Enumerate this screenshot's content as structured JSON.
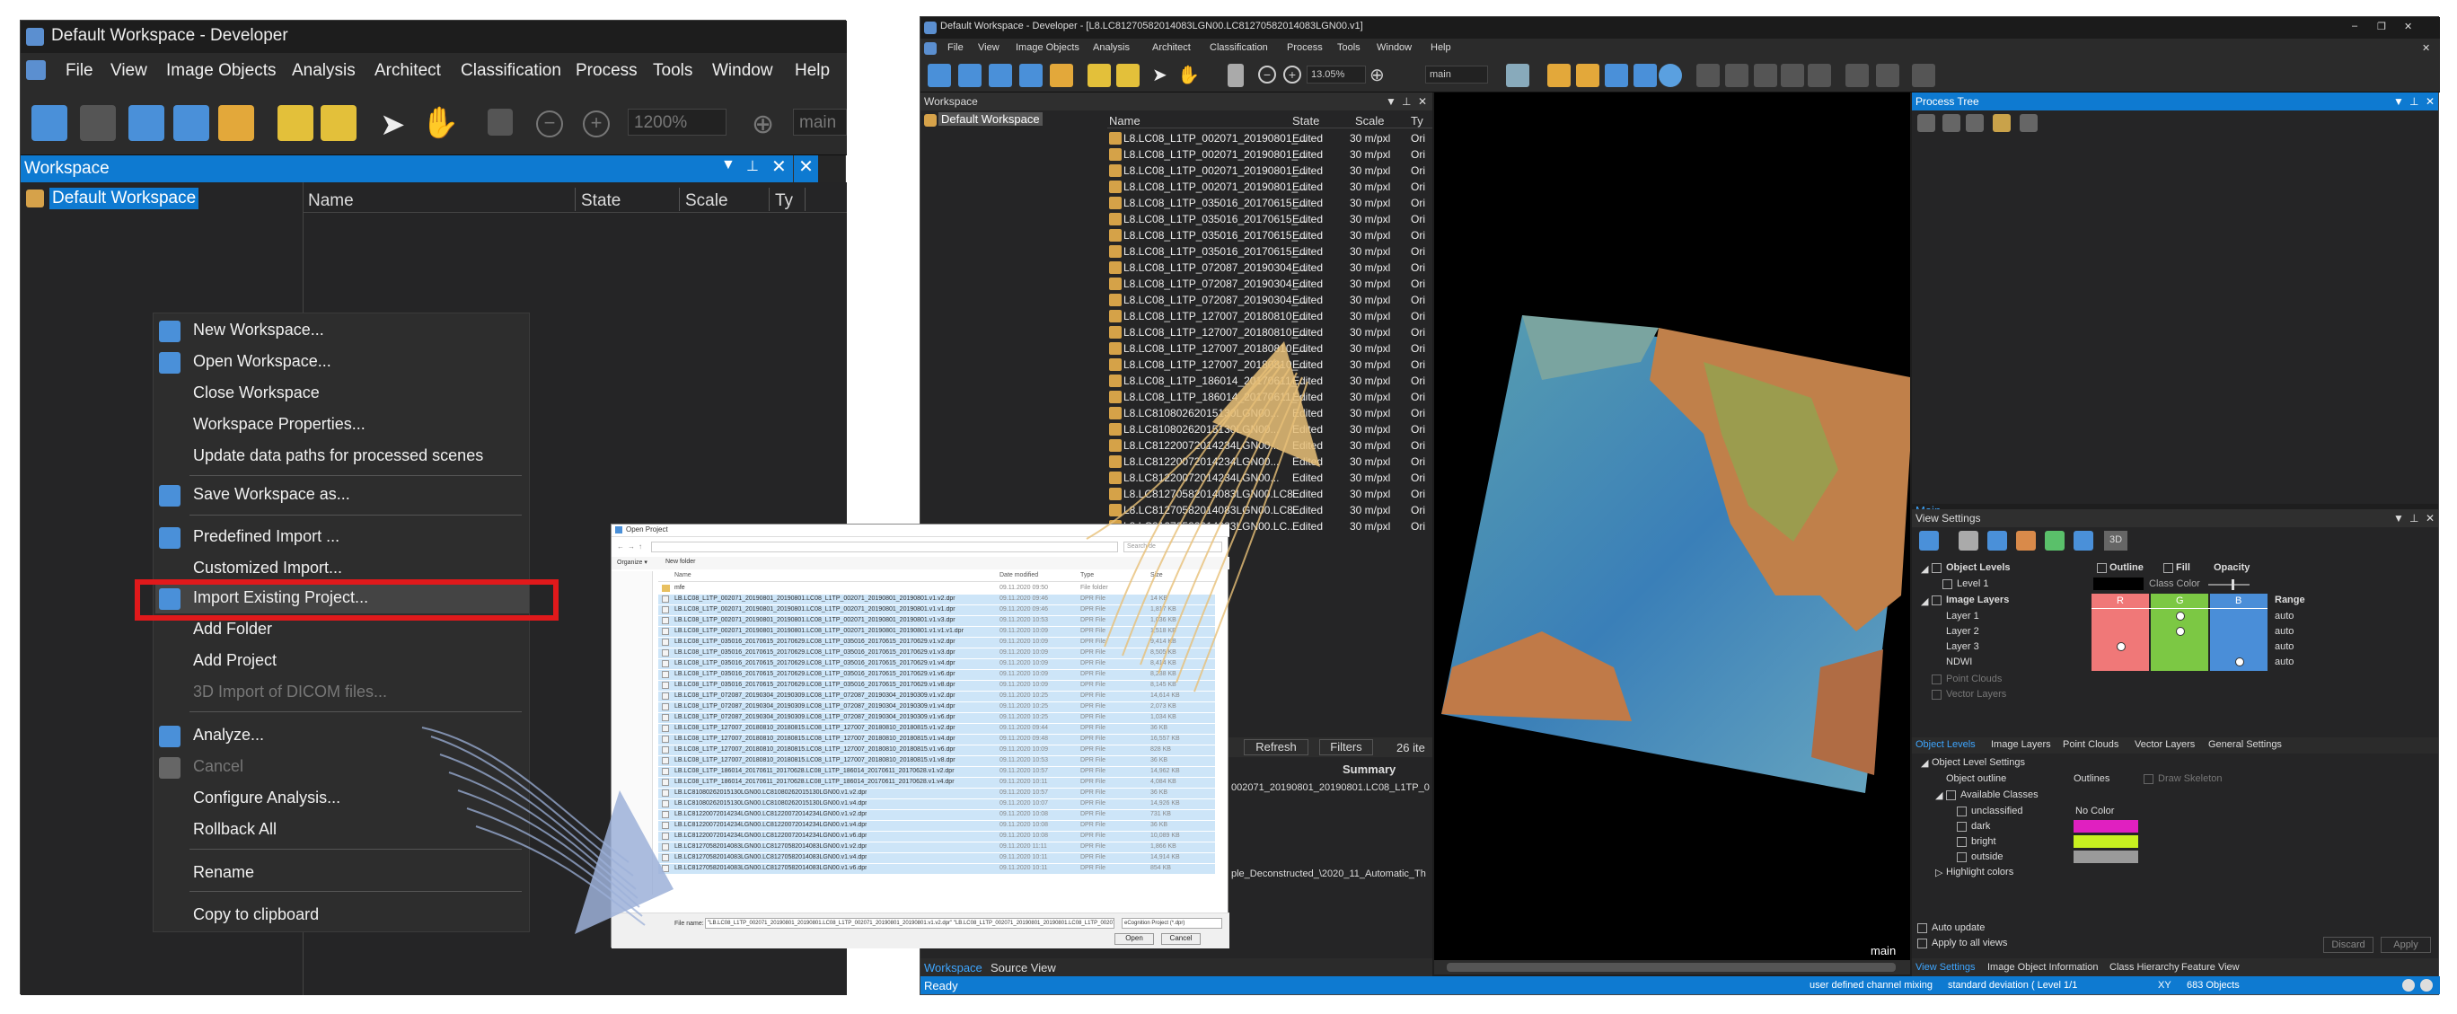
{
  "left_window": {
    "title": "Default Workspace - Developer",
    "menu": [
      "File",
      "View",
      "Image Objects",
      "Analysis",
      "Architect",
      "Classification",
      "Process",
      "Tools",
      "Window",
      "Help"
    ],
    "toolbar": {
      "zoom_value": "1200%",
      "view_select": "main"
    },
    "workspace_pane": {
      "title": "Workspace",
      "tree_root": "Default Workspace",
      "columns": [
        "Name",
        "State",
        "Scale",
        "Ty"
      ]
    }
  },
  "context_menu": {
    "items": [
      {
        "label": "New Workspace...",
        "icon": "new-workspace-icon",
        "enabled": true
      },
      {
        "label": "Open Workspace...",
        "icon": "open-workspace-icon",
        "enabled": true
      },
      {
        "label": "Close Workspace",
        "icon": "",
        "enabled": true
      },
      {
        "label": "Workspace Properties...",
        "icon": "",
        "enabled": true
      },
      {
        "label": "Update data paths for processed scenes",
        "icon": "",
        "enabled": true
      },
      {
        "label": "Save Workspace as...",
        "icon": "save-workspace-icon",
        "enabled": true
      },
      {
        "label": "Predefined Import ...",
        "icon": "predefined-import-icon",
        "enabled": true
      },
      {
        "label": "Customized Import...",
        "icon": "",
        "enabled": true
      },
      {
        "label": "Import Existing Project...",
        "icon": "import-project-icon",
        "enabled": true,
        "highlighted": true
      },
      {
        "label": "Add Folder",
        "icon": "",
        "enabled": true
      },
      {
        "label": "Add Project",
        "icon": "",
        "enabled": true
      },
      {
        "label": "3D Import of DICOM files...",
        "icon": "",
        "enabled": false
      },
      {
        "label": "Analyze...",
        "icon": "analyze-icon",
        "enabled": true
      },
      {
        "label": "Cancel",
        "icon": "cancel-icon",
        "enabled": false
      },
      {
        "label": "Configure Analysis...",
        "icon": "",
        "enabled": true
      },
      {
        "label": "Rollback All",
        "icon": "",
        "enabled": true
      },
      {
        "label": "Rename",
        "icon": "",
        "enabled": true
      },
      {
        "label": "Copy to clipboard",
        "icon": "",
        "enabled": true
      }
    ],
    "highlight_color": "#e0191b"
  },
  "dialog": {
    "title": "Open Project",
    "organize": "Organize ▾",
    "new_folder": "New folder",
    "search_placeholder": "Search de",
    "columns": [
      "Name",
      "Date modified",
      "Type",
      "Size"
    ],
    "folder_row": {
      "name": "mfe",
      "date": "09.11.2020 09:50",
      "type": "File folder",
      "size": ""
    },
    "rows": [
      {
        "name": "LB.LC08_L1TP_002071_20190801_20190801.LC08_L1TP_002071_20190801_20190801.v1.v2.dpr",
        "date": "09.11.2020 09:46",
        "type": "DPR File",
        "size": "14 KB"
      },
      {
        "name": "LB.LC08_L1TP_002071_20190801_20190801.LC08_L1TP_002071_20190801_20190801.v1.v1.dpr",
        "date": "09.11.2020 09:46",
        "type": "DPR File",
        "size": "1,817 KB"
      },
      {
        "name": "LB.LC08_L1TP_002071_20190801_20190801.LC08_L1TP_002071_20190801_20190801.v1.v3.dpr",
        "date": "09.11.2020 10:53",
        "type": "DPR File",
        "size": "1,036 KB"
      },
      {
        "name": "LB.LC08_L1TP_002071_20190801_20190801.LC08_L1TP_002071_20190801_20190801.v1.v1.v1.dpr",
        "date": "09.11.2020 10:09",
        "type": "DPR File",
        "size": "1,518 KB"
      },
      {
        "name": "LB.LC08_L1TP_035016_20170615_20170629.LC08_L1TP_035016_20170615_20170629.v1.v2.dpr",
        "date": "09.11.2020 10:09",
        "type": "DPR File",
        "size": "9,414 KB"
      },
      {
        "name": "LB.LC08_L1TP_035016_20170615_20170629.LC08_L1TP_035016_20170615_20170629.v1.v3.dpr",
        "date": "09.11.2020 10:09",
        "type": "DPR File",
        "size": "8,505 KB"
      },
      {
        "name": "LB.LC08_L1TP_035016_20170615_20170629.LC08_L1TP_035016_20170615_20170629.v1.v4.dpr",
        "date": "09.11.2020 10:09",
        "type": "DPR File",
        "size": "8,414 KB"
      },
      {
        "name": "LB.LC08_L1TP_035016_20170615_20170629.LC08_L1TP_035016_20170615_20170629.v1.v6.dpr",
        "date": "09.11.2020 10:09",
        "type": "DPR File",
        "size": "8,238 KB"
      },
      {
        "name": "LB.LC08_L1TP_035016_20170615_20170629.LC08_L1TP_035016_20170615_20170629.v1.v8.dpr",
        "date": "09.11.2020 10:09",
        "type": "DPR File",
        "size": "8,145 KB"
      },
      {
        "name": "LB.LC08_L1TP_072087_20190304_20190309.LC08_L1TP_072087_20190304_20190309.v1.v2.dpr",
        "date": "09.11.2020 10:25",
        "type": "DPR File",
        "size": "14,614 KB"
      },
      {
        "name": "LB.LC08_L1TP_072087_20190304_20190309.LC08_L1TP_072087_20190304_20190309.v1.v4.dpr",
        "date": "09.11.2020 10:25",
        "type": "DPR File",
        "size": "2,073 KB"
      },
      {
        "name": "LB.LC08_L1TP_072087_20190304_20190309.LC08_L1TP_072087_20190304_20190309.v1.v6.dpr",
        "date": "09.11.2020 10:25",
        "type": "DPR File",
        "size": "1,034 KB"
      },
      {
        "name": "LB.LC08_L1TP_127007_20180810_20180815.LC08_L1TP_127007_20180810_20180815.v1.v2.dpr",
        "date": "09.11.2020 09:44",
        "type": "DPR File",
        "size": "36 KB"
      },
      {
        "name": "LB.LC08_L1TP_127007_20180810_20180815.LC08_L1TP_127007_20180810_20180815.v1.v4.dpr",
        "date": "09.11.2020 09:48",
        "type": "DPR File",
        "size": "16,557 KB"
      },
      {
        "name": "LB.LC08_L1TP_127007_20180810_20180815.LC08_L1TP_127007_20180810_20180815.v1.v6.dpr",
        "date": "09.11.2020 10:09",
        "type": "DPR File",
        "size": "828 KB"
      },
      {
        "name": "LB.LC08_L1TP_127007_20180810_20180815.LC08_L1TP_127007_20180810_20180815.v1.v8.dpr",
        "date": "09.11.2020 10:53",
        "type": "DPR File",
        "size": "36 KB"
      },
      {
        "name": "LB.LC08_L1TP_186014_20170611_20170628.LC08_L1TP_186014_20170611_20170628.v1.v2.dpr",
        "date": "09.11.2020 10:57",
        "type": "DPR File",
        "size": "14,962 KB"
      },
      {
        "name": "LB.LC08_L1TP_186014_20170611_20170628.LC08_L1TP_186014_20170611_20170628.v1.v4.dpr",
        "date": "09.11.2020 10:11",
        "type": "DPR File",
        "size": "4,084 KB"
      },
      {
        "name": "LB.LC81080262015130LGN00.LC81080262015130LGN00.v1.v2.dpr",
        "date": "09.11.2020 10:57",
        "type": "DPR File",
        "size": "36 KB"
      },
      {
        "name": "LB.LC81080262015130LGN00.LC81080262015130LGN00.v1.v4.dpr",
        "date": "09.11.2020 10:07",
        "type": "DPR File",
        "size": "14,926 KB"
      },
      {
        "name": "LB.LC81220072014234LGN00.LC81220072014234LGN00.v1.v2.dpr",
        "date": "09.11.2020 10:08",
        "type": "DPR File",
        "size": "731 KB"
      },
      {
        "name": "LB.LC81220072014234LGN00.LC81220072014234LGN00.v1.v4.dpr",
        "date": "09.11.2020 10:08",
        "type": "DPR File",
        "size": "36 KB"
      },
      {
        "name": "LB.LC81220072014234LGN00.LC81220072014234LGN00.v1.v6.dpr",
        "date": "09.11.2020 10:08",
        "type": "DPR File",
        "size": "10,089 KB"
      },
      {
        "name": "LB.LC81270582014083LGN00.LC81270582014083LGN00.v1.v2.dpr",
        "date": "09.11.2020 11:11",
        "type": "DPR File",
        "size": "1,866 KB"
      },
      {
        "name": "LB.LC81270582014083LGN00.LC81270582014083LGN00.v1.v4.dpr",
        "date": "09.11.2020 10:11",
        "type": "DPR File",
        "size": "14,914 KB"
      },
      {
        "name": "LB.LC81270582014083LGN00.LC81270582014083LGN00.v1.v6.dpr",
        "date": "09.11.2020 10:11",
        "type": "DPR File",
        "size": "854 KB"
      }
    ],
    "file_name_label": "File name:",
    "file_name_value": "\"LB.LC08_L1TP_002071_20190801_20190801.LC08_L1TP_002071_20190801_20190801.v1.v2.dpr\" \"LB.LC08_L1TP_002071_20190801_20190801.LC08_L1TP_002071_20190801_20190801.v",
    "file_type": "eCognition Project (*.dpr)",
    "open_btn": "Open",
    "cancel_btn": "Cancel"
  },
  "right_window": {
    "title": "Default Workspace - Developer - [L8.LC81270582014083LGN00.LC81270582014083LGN00.v1]",
    "menu": [
      "File",
      "View",
      "Image Objects",
      "Analysis",
      "Architect",
      "Classification",
      "Process",
      "Tools",
      "Window",
      "Help"
    ],
    "toolbar": {
      "zoom_value": "13.05%",
      "view_select": "main"
    },
    "workspace": {
      "title": "Workspace",
      "root": "Default Workspace",
      "columns": [
        "Name",
        "State",
        "Scale",
        "Ty"
      ],
      "rows": [
        {
          "name": "L8.LC08_L1TP_002071_20190801_...",
          "state": "Edited",
          "scale": "30 m/pxl",
          "type": "Ori"
        },
        {
          "name": "L8.LC08_L1TP_002071_20190801_...",
          "state": "Edited",
          "scale": "30 m/pxl",
          "type": "Ori"
        },
        {
          "name": "L8.LC08_L1TP_002071_20190801_...",
          "state": "Edited",
          "scale": "30 m/pxl",
          "type": "Ori"
        },
        {
          "name": "L8.LC08_L1TP_002071_20190801_...",
          "state": "Edited",
          "scale": "30 m/pxl",
          "type": "Ori"
        },
        {
          "name": "L8.LC08_L1TP_035016_20170615_...",
          "state": "Edited",
          "scale": "30 m/pxl",
          "type": "Ori"
        },
        {
          "name": "L8.LC08_L1TP_035016_20170615_...",
          "state": "Edited",
          "scale": "30 m/pxl",
          "type": "Ori"
        },
        {
          "name": "L8.LC08_L1TP_035016_20170615_...",
          "state": "Edited",
          "scale": "30 m/pxl",
          "type": "Ori"
        },
        {
          "name": "L8.LC08_L1TP_035016_20170615_...",
          "state": "Edited",
          "scale": "30 m/pxl",
          "type": "Ori"
        },
        {
          "name": "L8.LC08_L1TP_072087_20190304_...",
          "state": "Edited",
          "scale": "30 m/pxl",
          "type": "Ori"
        },
        {
          "name": "L8.LC08_L1TP_072087_20190304_...",
          "state": "Edited",
          "scale": "30 m/pxl",
          "type": "Ori"
        },
        {
          "name": "L8.LC08_L1TP_072087_20190304_...",
          "state": "Edited",
          "scale": "30 m/pxl",
          "type": "Ori"
        },
        {
          "name": "L8.LC08_L1TP_127007_20180810_...",
          "state": "Edited",
          "scale": "30 m/pxl",
          "type": "Ori"
        },
        {
          "name": "L8.LC08_L1TP_127007_20180810_...",
          "state": "Edited",
          "scale": "30 m/pxl",
          "type": "Ori"
        },
        {
          "name": "L8.LC08_L1TP_127007_20180810_...",
          "state": "Edited",
          "scale": "30 m/pxl",
          "type": "Ori"
        },
        {
          "name": "L8.LC08_L1TP_127007_20180810_...",
          "state": "Edited",
          "scale": "30 m/pxl",
          "type": "Ori"
        },
        {
          "name": "L8.LC08_L1TP_186014_20170611_...",
          "state": "Edited",
          "scale": "30 m/pxl",
          "type": "Ori"
        },
        {
          "name": "L8.LC08_L1TP_186014_20170611_...",
          "state": "Edited",
          "scale": "30 m/pxl",
          "type": "Ori"
        },
        {
          "name": "L8.LC81080262015130LGN00...",
          "state": "Edited",
          "scale": "30 m/pxl",
          "type": "Ori"
        },
        {
          "name": "L8.LC81080262015130LGN00...",
          "state": "Edited",
          "scale": "30 m/pxl",
          "type": "Ori"
        },
        {
          "name": "L8.LC81220072014234LGN00...",
          "state": "Edited",
          "scale": "30 m/pxl",
          "type": "Ori"
        },
        {
          "name": "L8.LC81220072014234LGN00...",
          "state": "Edited",
          "scale": "30 m/pxl",
          "type": "Ori"
        },
        {
          "name": "L8.LC81220072014234LGN00...",
          "state": "Edited",
          "scale": "30 m/pxl",
          "type": "Ori"
        },
        {
          "name": "L8.LC81270582014083LGN00.LC8...",
          "state": "Edited",
          "scale": "30 m/pxl",
          "type": "Ori"
        },
        {
          "name": "L8.LC81270582014083LGN00.LC8...",
          "state": "Edited",
          "scale": "30 m/pxl",
          "type": "Ori"
        },
        {
          "name": "L8.LC81270582014083LGN00.LC...",
          "state": "Edited",
          "scale": "30 m/pxl",
          "type": "Ori"
        }
      ],
      "refresh": "Refresh",
      "filters": "Filters",
      "count": "26 ite",
      "summary_header": "Summary",
      "summary_line1": "002071_20190801_20190801.LC08_L1TP_0",
      "summary_line2": "ple_Deconstructed_\\2020_11_Automatic_Th",
      "tabs": [
        "Workspace",
        "Source View"
      ]
    },
    "viewer": {
      "label": "main"
    },
    "process_tree": {
      "title": "Process Tree",
      "tab": "Main"
    },
    "view_settings": {
      "title": "View Settings",
      "btn_3d": "3D",
      "object_levels": "Object Levels",
      "outline": "Outline",
      "fill": "Fill",
      "opacity": "Opacity",
      "level1": "Level 1",
      "class_color": "Class Color",
      "image_layers": "Image Layers",
      "rgb": [
        "R",
        "G",
        "B"
      ],
      "range": "Range",
      "layers": [
        {
          "name": "Layer 1",
          "range": "auto"
        },
        {
          "name": "Layer 2",
          "range": "auto"
        },
        {
          "name": "Layer 3",
          "range": "auto"
        },
        {
          "name": "NDWI",
          "range": "auto"
        }
      ],
      "point_clouds": "Point Clouds",
      "vector_layers": "Vector Layers",
      "tabs": [
        "Object Levels",
        "Image Layers",
        "Point Clouds",
        "Vector Layers",
        "General Settings"
      ],
      "ols_title": "Object Level Settings",
      "object_outline": "Object outline",
      "outlines": "Outlines",
      "draw_skeleton": "Draw Skeleton",
      "available_classes": "Available Classes",
      "classes": [
        {
          "name": "unclassified",
          "color": "No Color"
        },
        {
          "name": "dark",
          "color": "#e020c0"
        },
        {
          "name": "bright",
          "color": "#c8f020"
        },
        {
          "name": "outside",
          "color": "#9a9a9a"
        }
      ],
      "highlight_colors": "Highlight colors",
      "auto_update": "Auto update",
      "apply_all": "Apply to all views",
      "discard": "Discard",
      "apply": "Apply",
      "bottom_tabs": [
        "View Settings",
        "Image Object Information",
        "Class Hierarchy",
        "Feature View"
      ]
    },
    "status": {
      "ready": "Ready",
      "channel": "user defined channel mixing",
      "stddev": "standard deviation ( Level 1/1",
      "xy": "XY",
      "objects": "683 Objects"
    }
  }
}
